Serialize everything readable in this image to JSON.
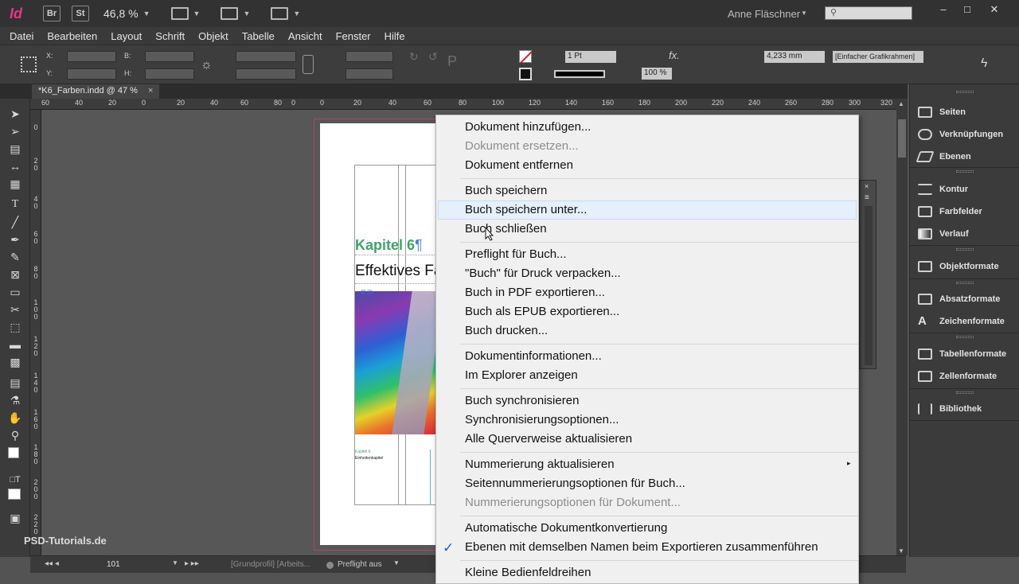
{
  "titlebar": {
    "app_icon": "Id",
    "bridge": "Br",
    "stock": "St",
    "zoom": "46,8 %",
    "user": "Anne Fläschner",
    "win_min": "–",
    "win_max": "□",
    "win_close": "✕"
  },
  "menubar": [
    "Datei",
    "Bearbeiten",
    "Layout",
    "Schrift",
    "Objekt",
    "Tabelle",
    "Ansicht",
    "Fenster",
    "Hilfe"
  ],
  "control": {
    "x": "X:",
    "y": "Y:",
    "b": "B:",
    "h": "H:",
    "stroke_weight": "1 Pt",
    "opacity": "100 %",
    "size_value": "4,233 mm",
    "frame_style": "[Einfacher Grafikrahmen]",
    "fx": "fx."
  },
  "tab": {
    "label": "*K6_Farben.indd @ 47 %",
    "close": "×"
  },
  "ruler": {
    "h": [
      "60",
      "40",
      "20",
      "0",
      "20",
      "40",
      "60",
      "80",
      "100",
      "120",
      "140",
      "160",
      "180",
      "200",
      "220",
      "240",
      "260",
      "280",
      "300",
      "320"
    ],
    "h_first": [
      "60",
      "40",
      "20",
      "0",
      "20",
      "40",
      "60",
      "80",
      "100",
      "120"
    ],
    "v": [
      "0",
      "2 0",
      "4 0",
      "6 0",
      "8 0",
      "1 0 0",
      "1 2 0",
      "1 4 0",
      "1 6 0",
      "1 8 0",
      "2 0 0",
      "2 2 0",
      "2 4 0"
    ]
  },
  "page": {
    "kapitel": "Kapitel 6",
    "pilcrow": "¶",
    "effektives": "Effektives Fa",
    "small1": "Kapitel 6",
    "small2": "Einheitenkapitel"
  },
  "menu": {
    "items": [
      {
        "label": "Dokument hinzufügen...",
        "disabled": false
      },
      {
        "label": "Dokument ersetzen...",
        "disabled": true
      },
      {
        "label": "Dokument entfernen",
        "disabled": false
      },
      {
        "label": "Buch speichern",
        "disabled": false
      },
      {
        "label": "Buch speichern unter...",
        "disabled": false,
        "highlighted": true
      },
      {
        "label": "Buch schließen",
        "disabled": false
      },
      {
        "label": "Preflight für Buch...",
        "disabled": false
      },
      {
        "label": "\"Buch\" für Druck verpacken...",
        "disabled": false
      },
      {
        "label": "Buch in PDF exportieren...",
        "disabled": false
      },
      {
        "label": "Buch als EPUB exportieren...",
        "disabled": false
      },
      {
        "label": "Buch drucken...",
        "disabled": false
      },
      {
        "label": "Dokumentinformationen...",
        "disabled": false
      },
      {
        "label": "Im Explorer anzeigen",
        "disabled": false
      },
      {
        "label": "Buch synchronisieren",
        "disabled": false
      },
      {
        "label": "Synchronisierungsoptionen...",
        "disabled": false
      },
      {
        "label": "Alle Querverweise aktualisieren",
        "disabled": false
      },
      {
        "label": "Nummerierung aktualisieren",
        "disabled": false,
        "submenu": true
      },
      {
        "label": "Seitennummerierungsoptionen für Buch...",
        "disabled": false
      },
      {
        "label": "Nummerierungsoptionen für Dokument...",
        "disabled": true
      },
      {
        "label": "Automatische Dokumentkonvertierung",
        "disabled": false
      },
      {
        "label": "Ebenen mit demselben Namen beim Exportieren zusammenführen",
        "disabled": false,
        "checked": true
      },
      {
        "label": "Kleine Bedienfeldreihen",
        "disabled": false
      }
    ],
    "submenu_arrow": "▸",
    "check": "✓"
  },
  "panels": [
    {
      "label": "Seiten",
      "icon": "pages-icon"
    },
    {
      "label": "Verknüpfungen",
      "icon": "links-icon"
    },
    {
      "label": "Ebenen",
      "icon": "layers-icon"
    },
    {
      "label": "Kontur",
      "icon": "stroke-icon"
    },
    {
      "label": "Farbfelder",
      "icon": "swatches-icon"
    },
    {
      "label": "Verlauf",
      "icon": "gradient-icon"
    },
    {
      "label": "Objektformate",
      "icon": "object-styles-icon"
    },
    {
      "label": "Absatzformate",
      "icon": "paragraph-styles-icon"
    },
    {
      "label": "Zeichenformate",
      "icon": "character-styles-icon"
    },
    {
      "label": "Tabellenformate",
      "icon": "table-styles-icon"
    },
    {
      "label": "Zellenformate",
      "icon": "cell-styles-icon"
    },
    {
      "label": "Bibliothek",
      "icon": "library-icon"
    }
  ],
  "status": {
    "page": "101",
    "profile": "[Grundprofil] [Arbeits...",
    "preflight": "Preflight aus"
  },
  "watermark": "PSD-Tutorials.de"
}
